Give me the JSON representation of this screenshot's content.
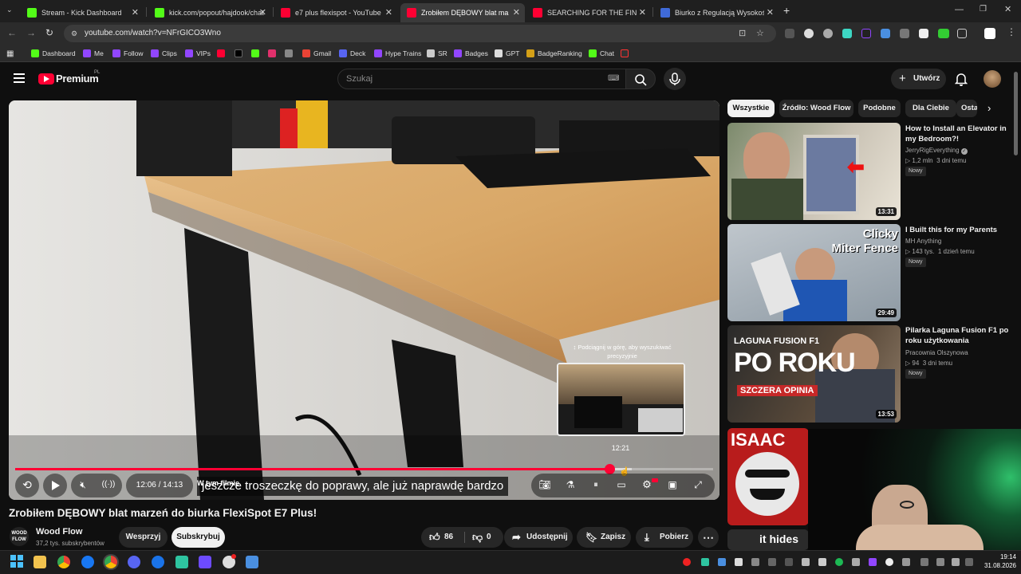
{
  "browser": {
    "tabs": [
      {
        "label": "Stream - Kick Dashboard",
        "color": "#53fc18"
      },
      {
        "label": "kick.com/popout/hajdook/chat",
        "color": "#53fc18"
      },
      {
        "label": "e7 plus flexispot - YouTube",
        "color": "#ff0033"
      },
      {
        "label": "Zrobiłem DĘBOWY blat marzeń",
        "color": "#ff0033",
        "active": true
      },
      {
        "label": "SEARCHING FOR THE FINAL PA",
        "color": "#ff0033"
      },
      {
        "label": "Biurko z Regulacją Wysokości E",
        "color": "#3f6ad8"
      }
    ],
    "new_tab": "+",
    "url": "youtube.com/watch?v=NFrGICO3Wno",
    "bookmarks": [
      {
        "label": "Dashboard",
        "color": "#53fc18"
      },
      {
        "label": "Me",
        "color": "#9146ff"
      },
      {
        "label": "Follow",
        "color": "#9146ff"
      },
      {
        "label": "Clips",
        "color": "#9146ff"
      },
      {
        "label": "VIPs",
        "color": "#9146ff"
      },
      {
        "label": "Gmail",
        "color": "#ea4335"
      },
      {
        "label": "Deck",
        "color": "#5865f2"
      },
      {
        "label": "Hype Trains",
        "color": "#9146ff"
      },
      {
        "label": "SR",
        "color": "#cccccc"
      },
      {
        "label": "Badges",
        "color": "#9146ff"
      },
      {
        "label": "GPT",
        "color": "#dddddd"
      },
      {
        "label": "BadgeRanking",
        "color": "#d4a017"
      },
      {
        "label": "Chat",
        "color": "#53fc18"
      }
    ]
  },
  "youtube": {
    "logo_text": "Premium",
    "logo_region": "PL",
    "search_placeholder": "Szukaj",
    "create_label": "Utwórz",
    "accent": "#ff0033"
  },
  "player": {
    "time_current": "12:06",
    "time_total": "14:13",
    "time_display": "12:06 / 14:13",
    "progress_fraction": 0.851,
    "buffer_fraction": 0.883,
    "chapter_label": "W tym filmie",
    "subtitle": "jeszcze troszeczkę do poprawy, ale już naprawdę bardzo",
    "preview_hint": "↕ Podciągnij w górę, aby wyszukiwać precyzyjnie",
    "preview_time": "12:21"
  },
  "video": {
    "title": "Zrobiłem DĘBOWY blat marzeń do biurka FlexiSpot E7 Plus!",
    "channel_name": "Wood Flow",
    "channel_avatar_text": "WOOD FLOW",
    "channel_subs": "37,2 tys. subskrybentów",
    "support_label": "Wesprzyj",
    "subscribe_label": "Subskrybuj",
    "likes": "86",
    "dislikes": "0",
    "share_label": "Udostępnij",
    "save_label": "Zapisz",
    "download_label": "Pobierz"
  },
  "sidebar": {
    "chips": [
      "Wszystkie",
      "Źródło: Wood Flow",
      "Podobne",
      "Dla Ciebie",
      "Ostatnio"
    ],
    "recommendations": [
      {
        "title": "How to Install an Elevator in my Bedroom?!",
        "channel": "JerryRigEverything",
        "verified": true,
        "views": "1,2 mln",
        "age": "3 dni temu",
        "badge": "Nowy",
        "duration": "13:31"
      },
      {
        "title": "I Built this for my Parents",
        "channel": "MH Anything",
        "views": "143 tys.",
        "age": "1 dzień temu",
        "badge": "Nowy",
        "duration": "29:49",
        "thumb_text": "Clicky Miter Fence"
      },
      {
        "title": "Pilarka Laguna Fusion F1 po roku użytkowania",
        "channel": "Pracownia Olszynowa",
        "views": "94",
        "age": "3 dni temu",
        "badge": "Nowy",
        "duration": "13:53",
        "thumb_text_1": "LAGUNA FUSION F1",
        "thumb_text_2": "PO ROKU",
        "thumb_text_3": "SZCZERA OPINIA"
      },
      {
        "title": "",
        "thumb_text_1": "ISAAC",
        "thumb_text_2": "it hides"
      }
    ]
  },
  "taskbar": {
    "time": "19:14",
    "date": "31.08.2026"
  }
}
